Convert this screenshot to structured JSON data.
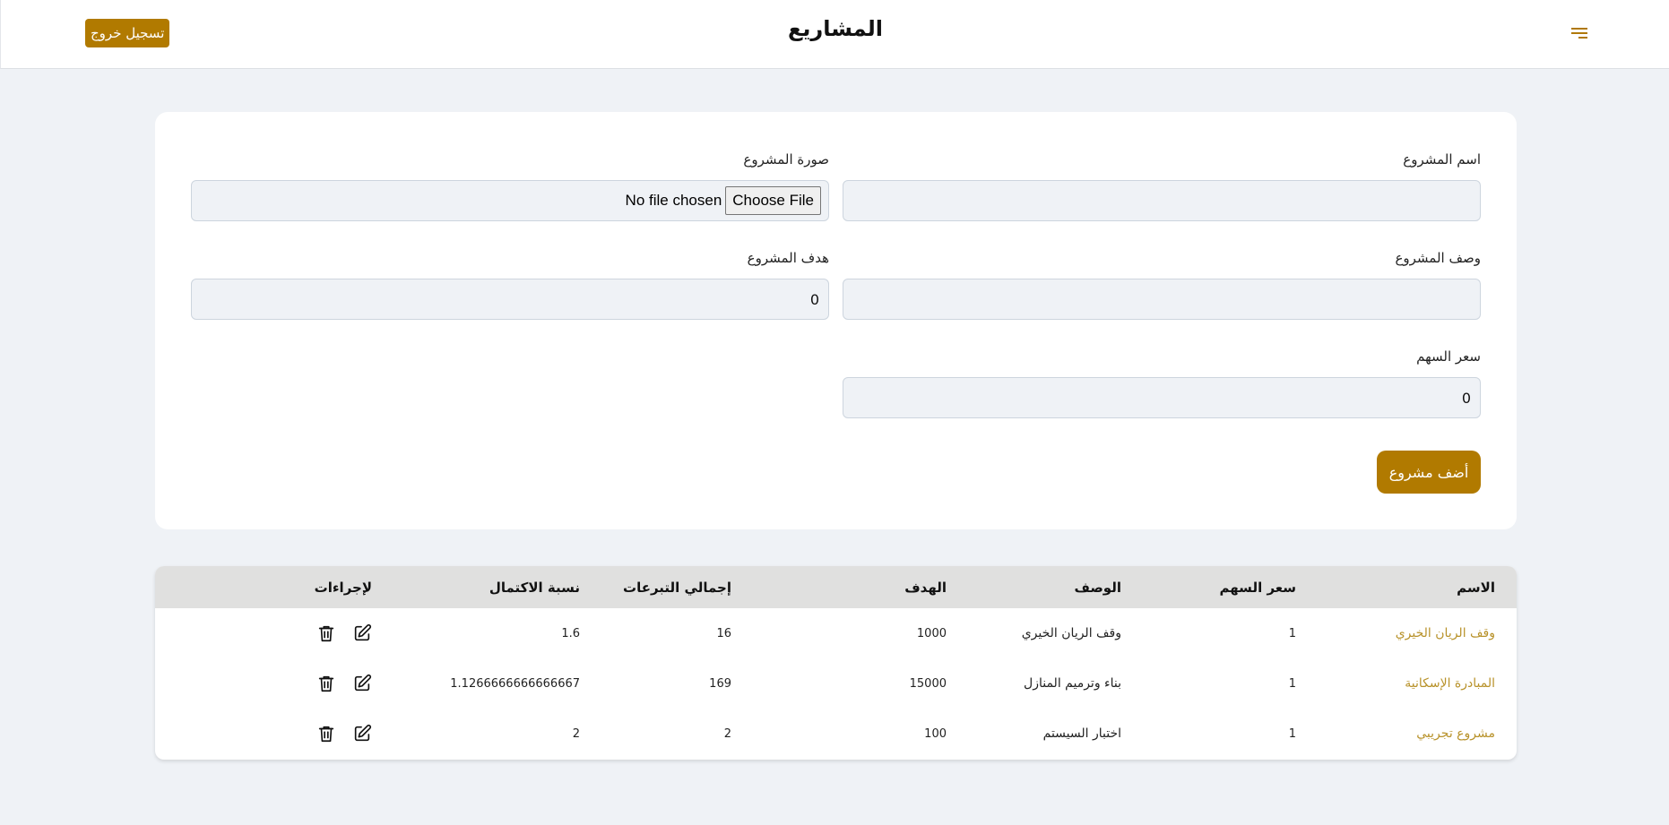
{
  "header": {
    "title": "المشاريع",
    "logout_label": "تسجيل خروج",
    "menu_icon": "hamburger-menu-icon"
  },
  "form": {
    "name": {
      "label": "اسم المشروع",
      "value": "",
      "placeholder": ""
    },
    "image": {
      "label": "صورة المشروع",
      "button_label": "Choose File",
      "status": "No file chosen"
    },
    "description": {
      "label": "وصف المشروع",
      "value": "",
      "placeholder": ""
    },
    "goal": {
      "label": "هدف المشروع",
      "value": "0"
    },
    "share_price": {
      "label": "سعر السهم",
      "value": "0"
    },
    "submit_label": "أضف مشروع"
  },
  "table": {
    "columns": [
      "الاسم",
      "سعر السهم",
      "الوصف",
      "الهدف",
      "إجمالي التبرعات",
      "نسبة الاكتمال",
      "لإجراءات"
    ],
    "rows": [
      {
        "name": "وقف الريان الخيري",
        "share_price": "1",
        "description": "وقف الريان الخيري",
        "goal": "1000",
        "total_donations": "16",
        "completion": "1.6"
      },
      {
        "name": "المبادرة الإسكانية",
        "share_price": "1",
        "description": "بناء وترميم المنازل",
        "goal": "15000",
        "total_donations": "169",
        "completion": "1.1266666666666667"
      },
      {
        "name": "مشروع تجريبي",
        "share_price": "1",
        "description": "اختبار السيستم",
        "goal": "100",
        "total_donations": "2",
        "completion": "2"
      }
    ],
    "row_actions": [
      "edit-icon",
      "trash-icon"
    ]
  },
  "colors": {
    "accent": "#b17a00",
    "name_link": "#b8922a",
    "page_bg": "#eff2f6",
    "table_header_bg": "#e0e0df"
  }
}
